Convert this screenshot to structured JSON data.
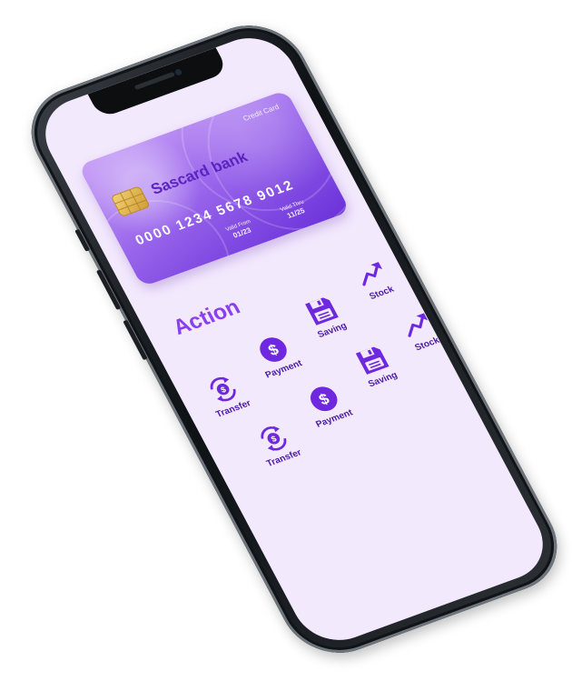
{
  "card": {
    "type_label": "Credit Card",
    "bank_name": "Sascard bank",
    "number": "0000 1234 5678 9012",
    "valid_from_label": "Valid From",
    "valid_from": "01/23",
    "valid_thru_label": "Valid Thru",
    "valid_thru": "11/25"
  },
  "action": {
    "title": "Action",
    "items": [
      {
        "label": "Transfer",
        "icon": "transfer-icon"
      },
      {
        "label": "Payment",
        "icon": "dollar-circle-icon"
      },
      {
        "label": "Saving",
        "icon": "floppy-disk-icon"
      },
      {
        "label": "Stock",
        "icon": "trend-up-icon"
      },
      {
        "label": "Transfer",
        "icon": "transfer-icon"
      },
      {
        "label": "Payment",
        "icon": "dollar-circle-icon"
      },
      {
        "label": "Saving",
        "icon": "floppy-disk-icon"
      },
      {
        "label": "Stock",
        "icon": "trend-up-icon"
      }
    ]
  },
  "colors": {
    "screen_background": "#f3e9fd",
    "accent": "#6e28e0",
    "title": "#8a3ff0",
    "label": "#4a1aa6",
    "phone_frame": "#0f1215"
  }
}
